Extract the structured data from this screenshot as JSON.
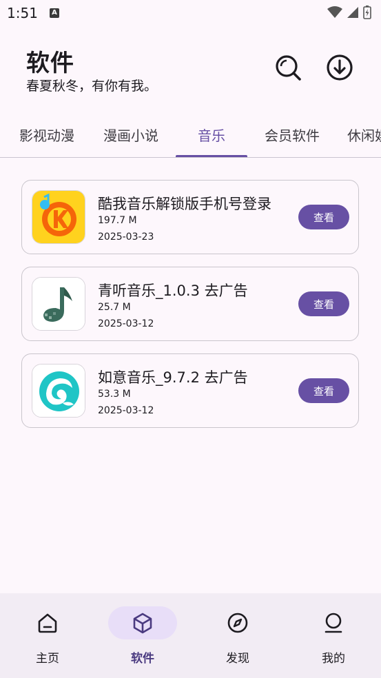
{
  "status_bar": {
    "time": "1:51",
    "notification_badge": "A"
  },
  "header": {
    "title": "软件",
    "subtitle": "春夏秋冬，有你有我。"
  },
  "tabs": [
    {
      "label": "影视动漫",
      "active": false
    },
    {
      "label": "漫画小说",
      "active": false
    },
    {
      "label": "音乐",
      "active": true
    },
    {
      "label": "会员软件",
      "active": false
    },
    {
      "label": "休闲娱",
      "active": false
    }
  ],
  "apps": [
    {
      "name": "酷我音乐解锁版手机号登录",
      "size": "197.7 M",
      "date": "2025-03-23",
      "button": "查看",
      "icon": "kuwo-music-icon"
    },
    {
      "name": "青听音乐_1.0.3 去广告",
      "size": "25.7 M",
      "date": "2025-03-12",
      "button": "查看",
      "icon": "qingting-music-icon"
    },
    {
      "name": "如意音乐_9.7.2 去广告",
      "size": "53.3 M",
      "date": "2025-03-12",
      "button": "查看",
      "icon": "ruyi-music-icon"
    }
  ],
  "bottom_nav": [
    {
      "label": "主页",
      "icon": "home-icon",
      "active": false
    },
    {
      "label": "软件",
      "icon": "cube-icon",
      "active": true
    },
    {
      "label": "发现",
      "icon": "compass-icon",
      "active": false
    },
    {
      "label": "我的",
      "icon": "person-icon",
      "active": false
    }
  ],
  "colors": {
    "accent": "#6750a4",
    "background": "#fdf7fc",
    "nav_background": "#f2ecf4",
    "active_pill": "#e8def8"
  }
}
